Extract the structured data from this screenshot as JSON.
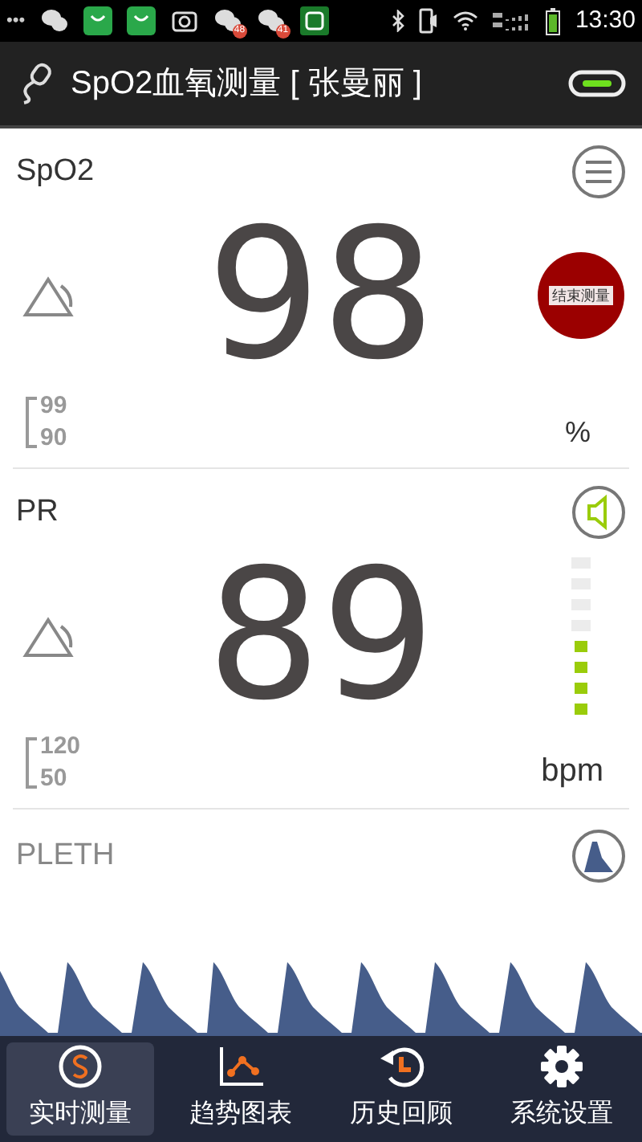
{
  "status_bar": {
    "more": "•••",
    "badges": [
      "48",
      "41"
    ],
    "time": "13:30"
  },
  "header": {
    "title": "SpO2血氧测量 [ 张曼丽 ]",
    "connected": true
  },
  "spo2": {
    "label": "SpO2",
    "value": "98",
    "high": "99",
    "low": "90",
    "unit": "%",
    "stop_button": "结束测量"
  },
  "pr": {
    "label": "PR",
    "value": "89",
    "high": "120",
    "low": "50",
    "unit": "bpm",
    "sound_on": true,
    "pulse": {
      "level": 0.5
    }
  },
  "pleth": {
    "label": "PLETH"
  },
  "nav": [
    {
      "label": "实时测量",
      "selected": true
    },
    {
      "label": "趋势图表",
      "selected": false
    },
    {
      "label": "历史回顾",
      "selected": false
    },
    {
      "label": "系统设置",
      "selected": false
    }
  ]
}
